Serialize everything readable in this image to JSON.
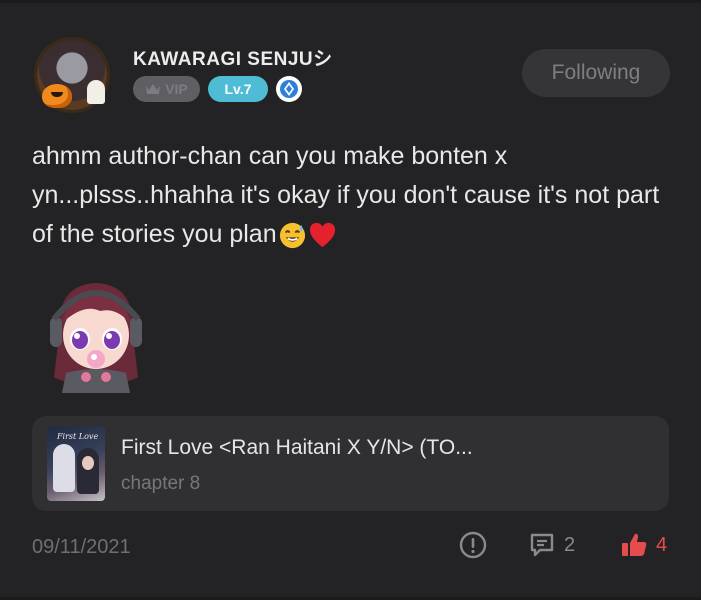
{
  "user": {
    "name": "KAWARAGI SENJUシ",
    "vip_label": "VIP",
    "level_label": "Lv.7"
  },
  "follow_button": {
    "label": "Following"
  },
  "comment": {
    "text": "ahmm author-chan can you make bonten x yn...plsss..hhahha it's okay if you don't cause it's not part of the stories you plan"
  },
  "story": {
    "cover_text": "First Love",
    "title": "First Love <Ran Haitani X Y/N> (TO...",
    "chapter": "chapter 8"
  },
  "footer": {
    "date": "09/11/2021",
    "comment_count": "2",
    "like_count": "4"
  },
  "colors": {
    "background": "#232325",
    "level_badge": "#4fbcd6",
    "like": "#e74c4c"
  },
  "icons": {
    "report": "report-icon",
    "comment": "comment-icon",
    "like": "thumbs-up-icon",
    "gem": "gem-icon",
    "crown": "crown-icon"
  }
}
